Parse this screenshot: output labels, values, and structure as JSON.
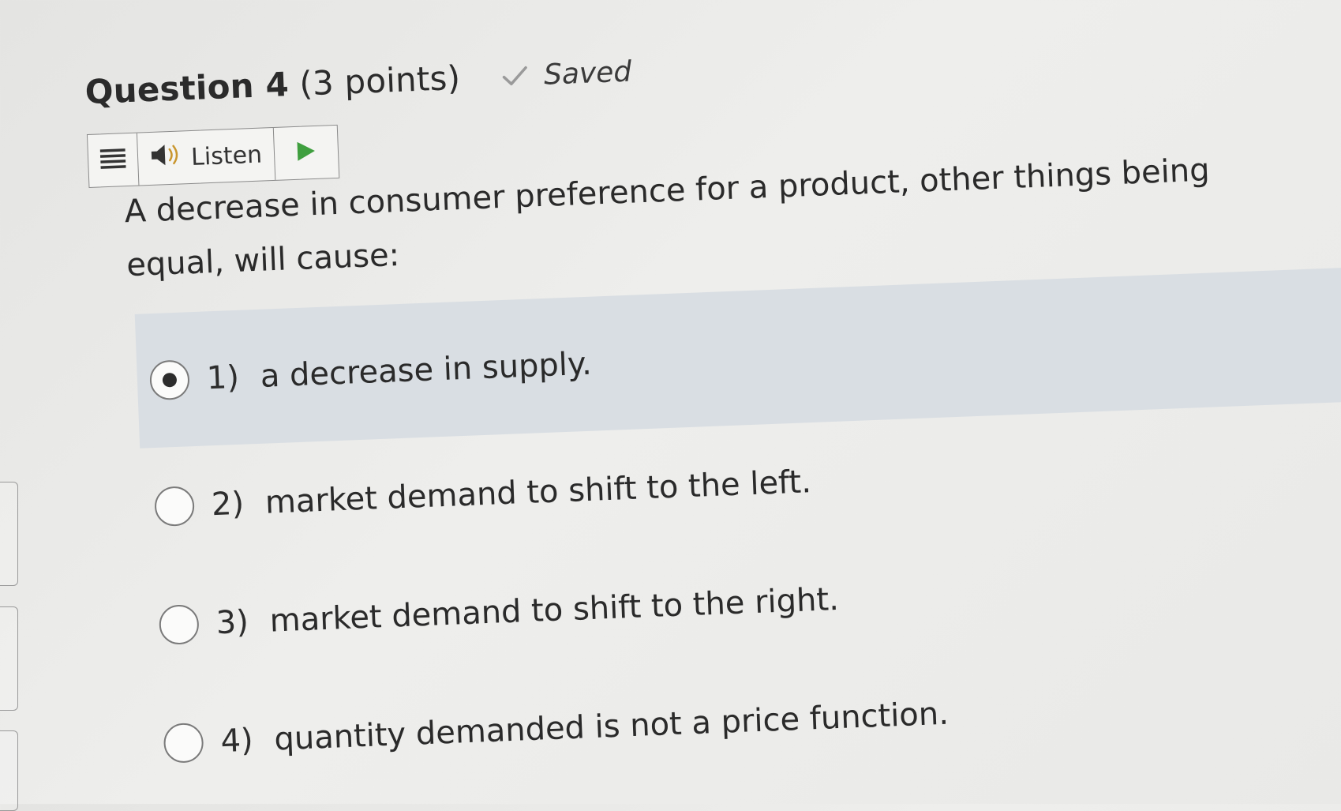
{
  "question": {
    "title_main": "Question 4",
    "title_points": "(3 points)",
    "saved_label": "Saved",
    "text": "A decrease in consumer preference for a product, other things being equal, will cause:"
  },
  "listen_bar": {
    "listen_label": "Listen"
  },
  "options": [
    {
      "num": "1)",
      "label": "a decrease in supply.",
      "selected": true
    },
    {
      "num": "2)",
      "label": "market demand to shift to the left.",
      "selected": false
    },
    {
      "num": "3)",
      "label": "market demand to shift to the right.",
      "selected": false
    },
    {
      "num": "4)",
      "label": "quantity demanded is not a price function.",
      "selected": false
    }
  ],
  "colors": {
    "selected_bg": "#d9dee3",
    "play_green": "#3f9f3f",
    "check_gray": "#9a9a9a"
  }
}
